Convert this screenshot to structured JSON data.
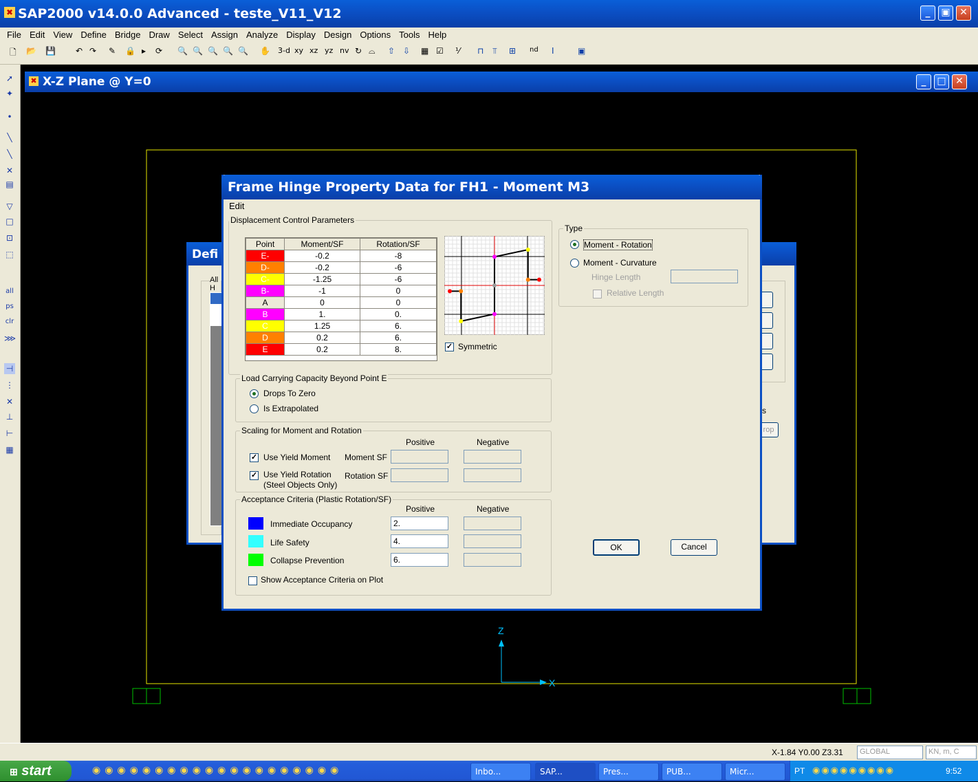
{
  "app": {
    "title": "SAP2000 v14.0.0 Advanced  - teste_V11_V12",
    "min": "_",
    "restore": "▣",
    "close": "✕"
  },
  "menu": [
    "File",
    "Edit",
    "View",
    "Define",
    "Bridge",
    "Draw",
    "Select",
    "Assign",
    "Analyze",
    "Display",
    "Design",
    "Options",
    "Tools",
    "Help"
  ],
  "toolbar": {
    "view_3d": "3-d",
    "view_xy": "xy",
    "view_xz": "xz",
    "view_yz": "yz",
    "view_nv": "nv",
    "nd": "nd"
  },
  "viewport": {
    "title": "X-Z Plane @ Y=0",
    "axis_z": "Z",
    "axis_x": "X"
  },
  "bg_dialog": {
    "title": "Defi",
    "group": "All H",
    "side_label": "s",
    "side_btn": "rop"
  },
  "dialog": {
    "title": "Frame Hinge Property Data for FH1 - Moment M3",
    "menu": "Edit",
    "disp_group": "Displacement Control Parameters",
    "table": {
      "headers": [
        "Point",
        "Moment/SF",
        "Rotation/SF"
      ],
      "rows": [
        {
          "point": "E-",
          "moment": "-0.2",
          "rotation": "-8",
          "color": "#ff0000"
        },
        {
          "point": "D-",
          "moment": "-0.2",
          "rotation": "-6",
          "color": "#ff8000"
        },
        {
          "point": "C-",
          "moment": "-1.25",
          "rotation": "-6",
          "color": "#ffff00"
        },
        {
          "point": "B-",
          "moment": "-1",
          "rotation": "0",
          "color": "#ff00ff"
        },
        {
          "point": "A",
          "moment": "0",
          "rotation": "0",
          "color": "#ece9d8"
        },
        {
          "point": "B",
          "moment": "1.",
          "rotation": "0.",
          "color": "#ff00ff"
        },
        {
          "point": "C",
          "moment": "1.25",
          "rotation": "6.",
          "color": "#ffff00"
        },
        {
          "point": "D",
          "moment": "0.2",
          "rotation": "6.",
          "color": "#ff8000"
        },
        {
          "point": "E",
          "moment": "0.2",
          "rotation": "8.",
          "color": "#ff0000"
        }
      ]
    },
    "symmetric_label": "Symmetric",
    "load_group": "Load Carrying Capacity Beyond Point E",
    "drops_label": "Drops To Zero",
    "extrap_label": "Is Extrapolated",
    "scaling_group": "Scaling for Moment and Rotation",
    "positive": "Positive",
    "negative": "Negative",
    "use_yield_moment": "Use Yield Moment",
    "moment_sf": "Moment SF",
    "use_yield_rotation": "Use Yield Rotation",
    "steel_only": "(Steel Objects Only)",
    "rotation_sf": "Rotation SF",
    "accept_group": "Acceptance Criteria (Plastic Rotation/SF)",
    "io_label": "Immediate Occupancy",
    "ls_label": "Life Safety",
    "cp_label": "Collapse Prevention",
    "io_value": "2.",
    "ls_value": "4.",
    "cp_value": "6.",
    "io_color": "#0000ff",
    "ls_color": "#33ffff",
    "cp_color": "#00ff00",
    "show_accept": "Show Acceptance Criteria on Plot",
    "type_group": "Type",
    "moment_rotation": "Moment - Rotation",
    "moment_curvature": "Moment - Curvature",
    "hinge_length": "Hinge Length",
    "relative_length": "Relative Length",
    "ok": "OK",
    "cancel": "Cancel"
  },
  "status": {
    "coords": "X-1.84  Y0.00  Z3.31",
    "coord_sys": "GLOBAL",
    "units": "KN, m, C"
  },
  "taskbar": {
    "start": "start",
    "tasks": [
      "Inbo...",
      "SAP...",
      "Pres...",
      "PUB...",
      "Micr..."
    ],
    "lang": "PT",
    "time": "9:52"
  }
}
